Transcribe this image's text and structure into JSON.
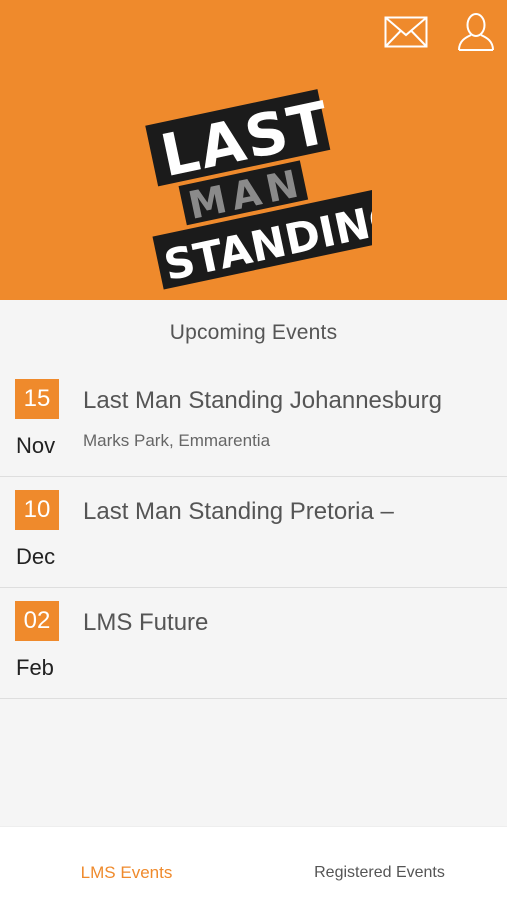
{
  "header": {
    "mail_icon": "envelope-icon",
    "profile_icon": "user-icon",
    "logo": {
      "line1": "LAST",
      "line2": "MAN",
      "line3": "STANDING"
    }
  },
  "section_title": "Upcoming Events",
  "events": [
    {
      "day": "15",
      "month": "Nov",
      "title": "Last Man Standing Johannesburg",
      "subtitle": "Marks Park, Emmarentia"
    },
    {
      "day": "10",
      "month": "Dec",
      "title": "Last Man Standing Pretoria –",
      "subtitle": ""
    },
    {
      "day": "02",
      "month": "Feb",
      "title": "LMS Future",
      "subtitle": ""
    }
  ],
  "bottom_nav": {
    "tab_events": "LMS Events",
    "tab_registered": "Registered Events"
  },
  "colors": {
    "accent": "#ef8a2c",
    "logo_grey": "#8a8a8a"
  }
}
